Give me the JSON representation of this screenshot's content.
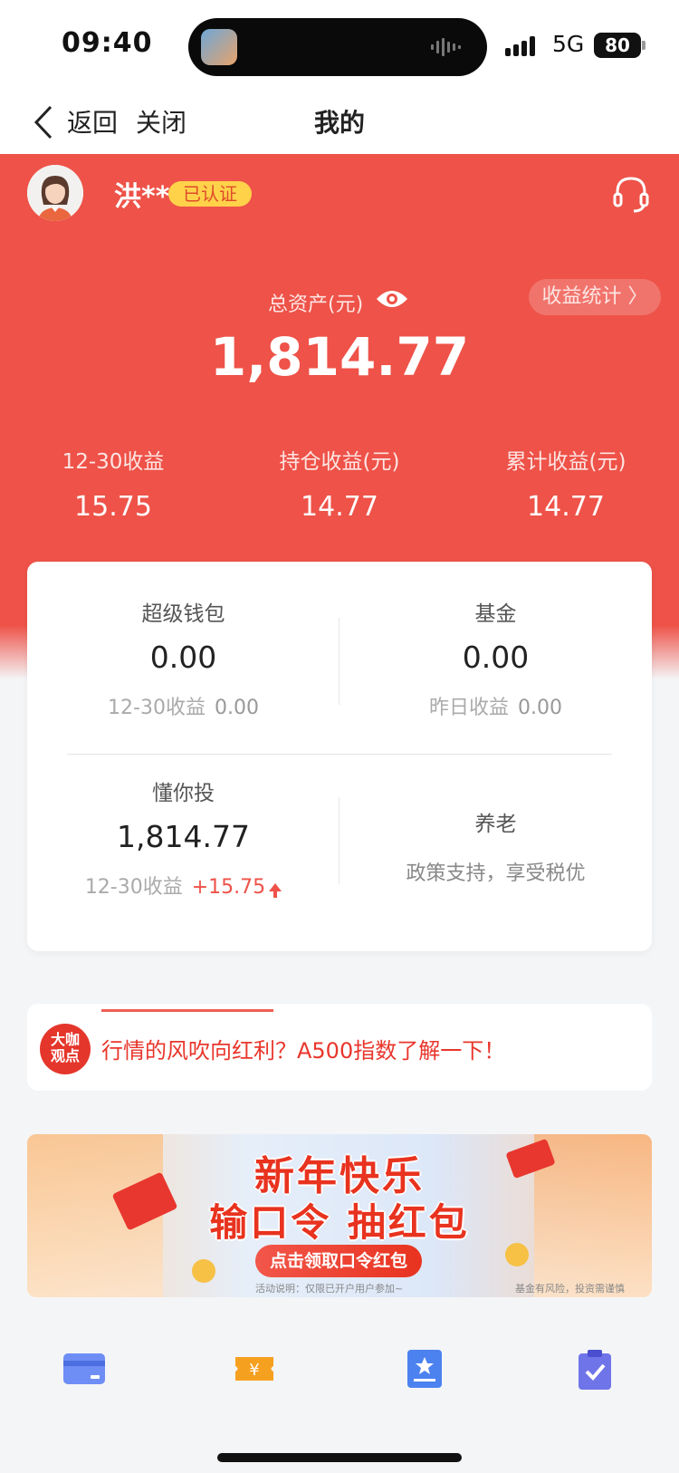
{
  "status_bar": {
    "time": "09:40",
    "network": "5G",
    "battery": "80"
  },
  "nav": {
    "back_label": "返回",
    "close_label": "关闭",
    "title": "我的"
  },
  "user": {
    "name": "洪**",
    "badge": "已认证"
  },
  "overview": {
    "total_label": "总资产(元)",
    "stats_button": "收益统计 〉",
    "total_value": "1,814.77",
    "kpis": [
      {
        "label": "12-30收益",
        "value": "15.75"
      },
      {
        "label": "持仓收益(元)",
        "value": "14.77"
      },
      {
        "label": "累计收益(元)",
        "value": "14.77"
      }
    ]
  },
  "assets": {
    "wallet": {
      "title": "超级钱包",
      "value": "0.00",
      "sub_label": "12-30收益",
      "sub_value": "0.00"
    },
    "fund": {
      "title": "基金",
      "value": "0.00",
      "sub_label": "昨日收益",
      "sub_value": "0.00"
    },
    "robo": {
      "title": "懂你投",
      "value": "1,814.77",
      "sub_label": "12-30收益",
      "sub_value": "+15.75"
    },
    "pension": {
      "title": "养老",
      "desc": "政策支持，享受税优"
    }
  },
  "news": {
    "badge": "大咖观点",
    "text": "行情的风吹向红利？A500指数了解一下！"
  },
  "banner": {
    "line1": "新年快乐",
    "line2": "输口令 抽红包",
    "button": "点击领取口令红包",
    "note": "活动说明：仅限已开户用户参加~",
    "risk": "基金有风险，投资需谨慎"
  },
  "colors": {
    "brand_red": "#ee5248",
    "gold": "#ffd24a"
  }
}
